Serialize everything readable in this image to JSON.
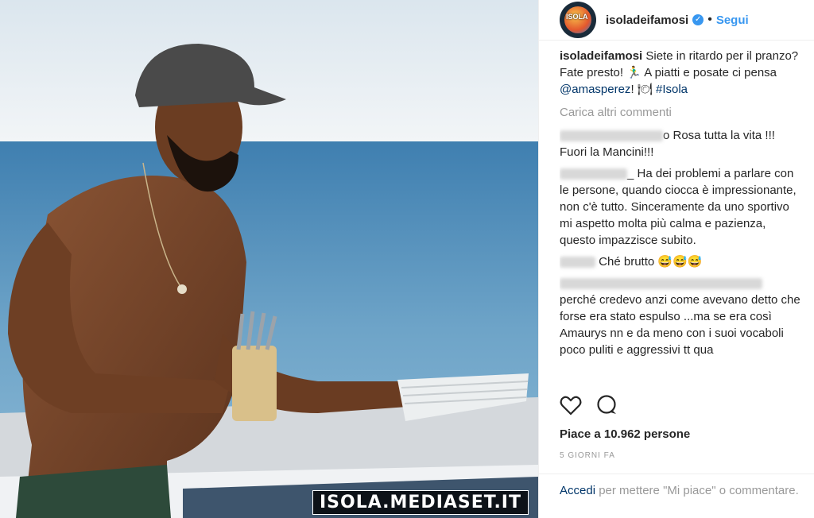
{
  "post": {
    "username": "isoladeifamosi",
    "verified_mark": "✓",
    "separator": "•",
    "follow_label": "Segui",
    "avatar_text": "ISOLA",
    "watermark": "ISOLA.MEDIASET.IT"
  },
  "caption": {
    "username": "isoladeifamosi",
    "text": "Siete in ritardo per il pranzo? Fate presto! 🏃‍♂️ A piatti e posate ci pensa",
    "mention": "@amasperez",
    "after_mention": "! 🍽",
    "hashtag": "#Isola"
  },
  "load_more_label": "Carica altri commenti",
  "comments": [
    {
      "text": "o Rosa tutta la vita !!! Fuori la Mancini!!!"
    },
    {
      "text": "_ Ha dei problemi a parlare con le persone, quando ciocca è impressionante, non c'è tutto. Sinceramente da uno sportivo mi aspetto molta più calma e pazienza, questo impazzisce subito."
    },
    {
      "text": "Ché brutto 😅😅😅"
    },
    {
      "text": "perché credevo anzi come avevano detto che forse era stato espulso ...ma se era così Amaurys nn e da meno con i suoi vocaboli poco puliti e aggressivi tt qua"
    }
  ],
  "actions": {
    "like_icon": "heart-icon",
    "comment_icon": "comment-icon"
  },
  "likes_text": "Piace a 10.962 persone",
  "date_text": "5 GIORNI FA",
  "footer": {
    "login_label": "Accedi",
    "rest": " per mettere \"Mi piace\" o commentare."
  }
}
